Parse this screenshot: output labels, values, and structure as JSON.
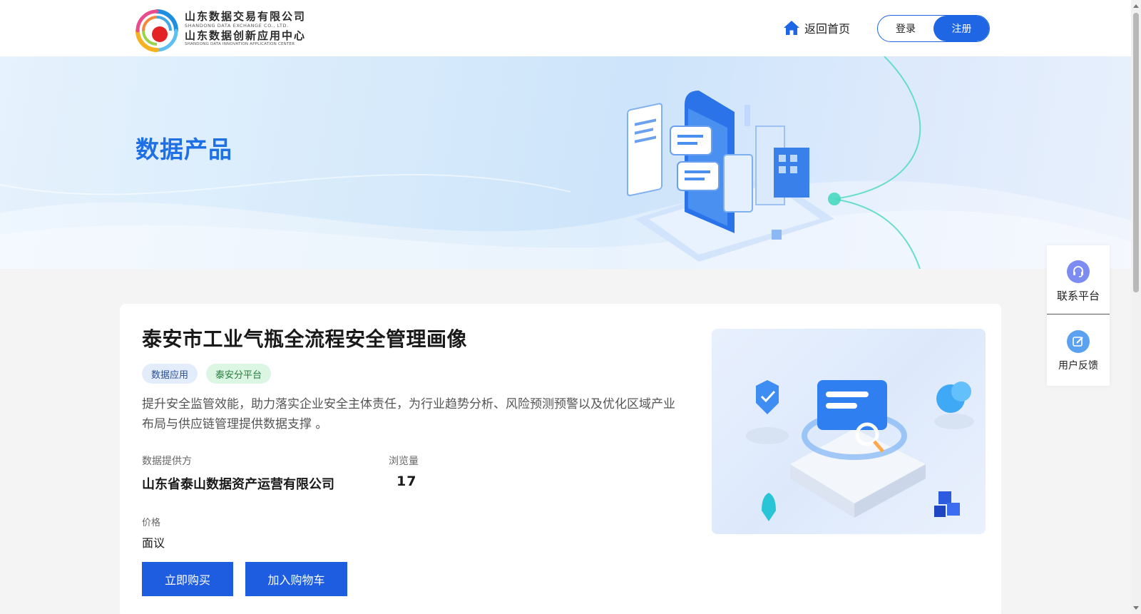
{
  "header": {
    "logo": {
      "cn_line1": "山东数据交易有限公司",
      "en_line1": "SHANDONG DATA EXCHANGE CO., LTD.",
      "cn_line2": "山东数据创新应用中心",
      "en_line2": "SHANDONG DATA INNOVATION APPLICATION CENTER"
    },
    "home_label": "返回首页",
    "login_label": "登录",
    "register_label": "注册"
  },
  "banner": {
    "title": "数据产品"
  },
  "product": {
    "title": "泰安市工业气瓶全流程安全管理画像",
    "tags": [
      "数据应用",
      "泰安分平台"
    ],
    "description": "提升安全监管效能，助力落实企业安全主体责任，为行业趋势分析、风险预测预警以及优化区域产业布局与供应链管理提供数据支撑 。",
    "provider_label": "数据提供方",
    "provider_value": "山东省泰山数据资产运营有限公司",
    "views_label": "浏览量",
    "views_value": "17",
    "price_label": "价格",
    "price_value": "面议",
    "buy_label": "立即购买",
    "cart_label": "加入购物车"
  },
  "side_panel": {
    "contact_label": "联系平台",
    "feedback_label": "用户反馈"
  },
  "colors": {
    "primary": "#1f66e5",
    "button": "#1f5de0",
    "banner_title": "#1f6fe5",
    "tag_blue_bg": "#e2ecfb",
    "tag_green_bg": "#dcf6e4"
  },
  "icons": {
    "home": "home-icon",
    "contact": "headset-icon",
    "feedback": "edit-icon"
  }
}
